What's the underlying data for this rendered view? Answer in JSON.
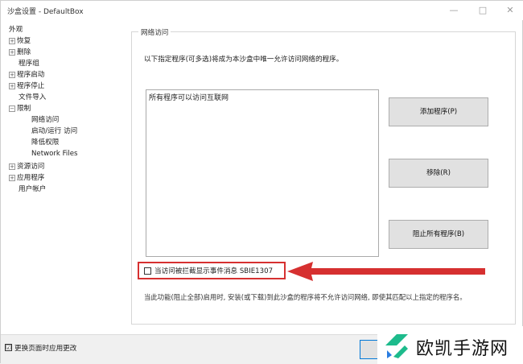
{
  "window": {
    "title": "沙盒设置 - DefaultBox",
    "minimize": "—",
    "maximize": "□",
    "close": "✕"
  },
  "tree": {
    "items": [
      {
        "label": "外观",
        "exp": ""
      },
      {
        "label": "恢复",
        "exp": "+"
      },
      {
        "label": "删除",
        "exp": "+"
      },
      {
        "label": "程序组",
        "exp": ""
      },
      {
        "label": "程序启动",
        "exp": "+"
      },
      {
        "label": "程序停止",
        "exp": "+"
      },
      {
        "label": "文件导入",
        "exp": ""
      },
      {
        "label": "限制",
        "exp": "−"
      },
      {
        "label": "网络访问",
        "exp": ""
      },
      {
        "label": "启动/运行 访问",
        "exp": ""
      },
      {
        "label": "降低权限",
        "exp": ""
      },
      {
        "label": "Network Files",
        "exp": ""
      },
      {
        "label": "资源访问",
        "exp": "+"
      },
      {
        "label": "应用程序",
        "exp": "+"
      },
      {
        "label": "用户帐户",
        "exp": ""
      }
    ]
  },
  "main": {
    "group_title": "网络访问",
    "description": "以下指定程序(可多选)将成为本沙盒中唯一允许访问网络的程序。",
    "list_item": "所有程序可以访问互联网",
    "buttons": {
      "add": "添加程序(P)",
      "remove": "移除(R)",
      "block_all": "阻止所有程序(B)"
    },
    "checkbox_label": "当访问被拦截显示事件消息 SBIE1307",
    "note": "当此功能(阻止全部)启用时, 安装(或下载)到此沙盒的程序将不允许访问网络, 即使其匹配以上指定的程序名。"
  },
  "footer": {
    "apply_checkbox": "更换页面时应用更改",
    "apply_checked": "☑"
  },
  "watermark": {
    "text": "欧凯手游网"
  },
  "colors": {
    "highlight": "#d63030",
    "button_bg": "#e1e1e1"
  }
}
